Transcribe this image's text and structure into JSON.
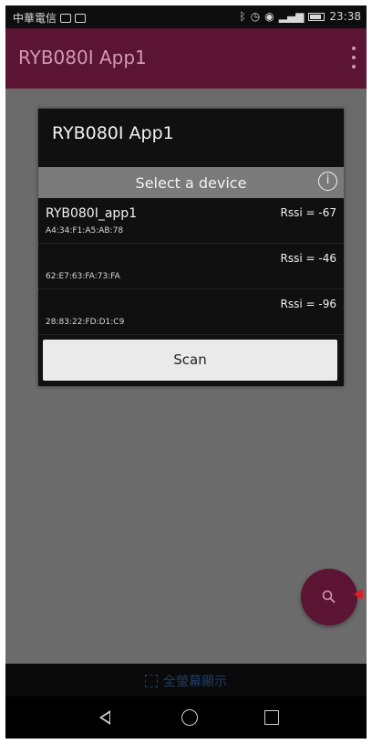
{
  "status_bar": {
    "carrier": "中華電信",
    "time": "23:38",
    "icons": [
      "bluetooth-icon",
      "alarm-icon",
      "eye-icon",
      "signal-icon",
      "battery-icon"
    ]
  },
  "app_bar": {
    "title": "RYB080I App1",
    "color": "#5b1432"
  },
  "dialog": {
    "title": "RYB080I App1",
    "header": "Select a device",
    "devices": [
      {
        "name": "RYB080I_app1",
        "address": "A4:34:F1:A5:AB:78",
        "rssi": "Rssi = -67"
      },
      {
        "name": "",
        "address": "62:E7:63:FA:73:FA",
        "rssi": "Rssi = -46"
      },
      {
        "name": "",
        "address": "28:83:22:FD:D1:C9",
        "rssi": "Rssi = -96"
      }
    ],
    "scan_label": "Scan"
  },
  "fullscreen_bar": {
    "label": "全螢幕顯示"
  }
}
